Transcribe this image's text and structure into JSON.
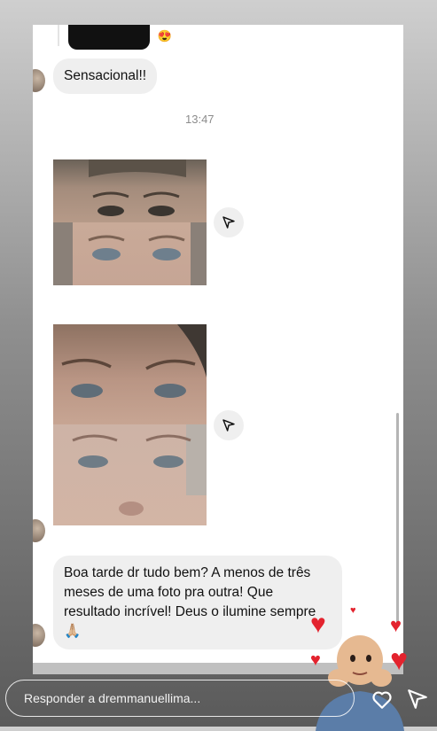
{
  "conversation": {
    "messages": [
      {
        "text": "Sensacional!!"
      },
      {
        "text": "Boa tarde dr tudo bem? A menos de três  meses de uma foto pra outra! Que resultado  incrível! Deus o ilumine sempre 🙏🏼"
      }
    ],
    "timestamp": "13:47",
    "sticker_emoji": "😍"
  },
  "reply": {
    "placeholder": "Responder a dremmanuellima..."
  },
  "colors": {
    "bubble": "#efefef",
    "heart": "#e3232e"
  },
  "icons": [
    "send-icon",
    "heart-icon",
    "share-icon"
  ]
}
